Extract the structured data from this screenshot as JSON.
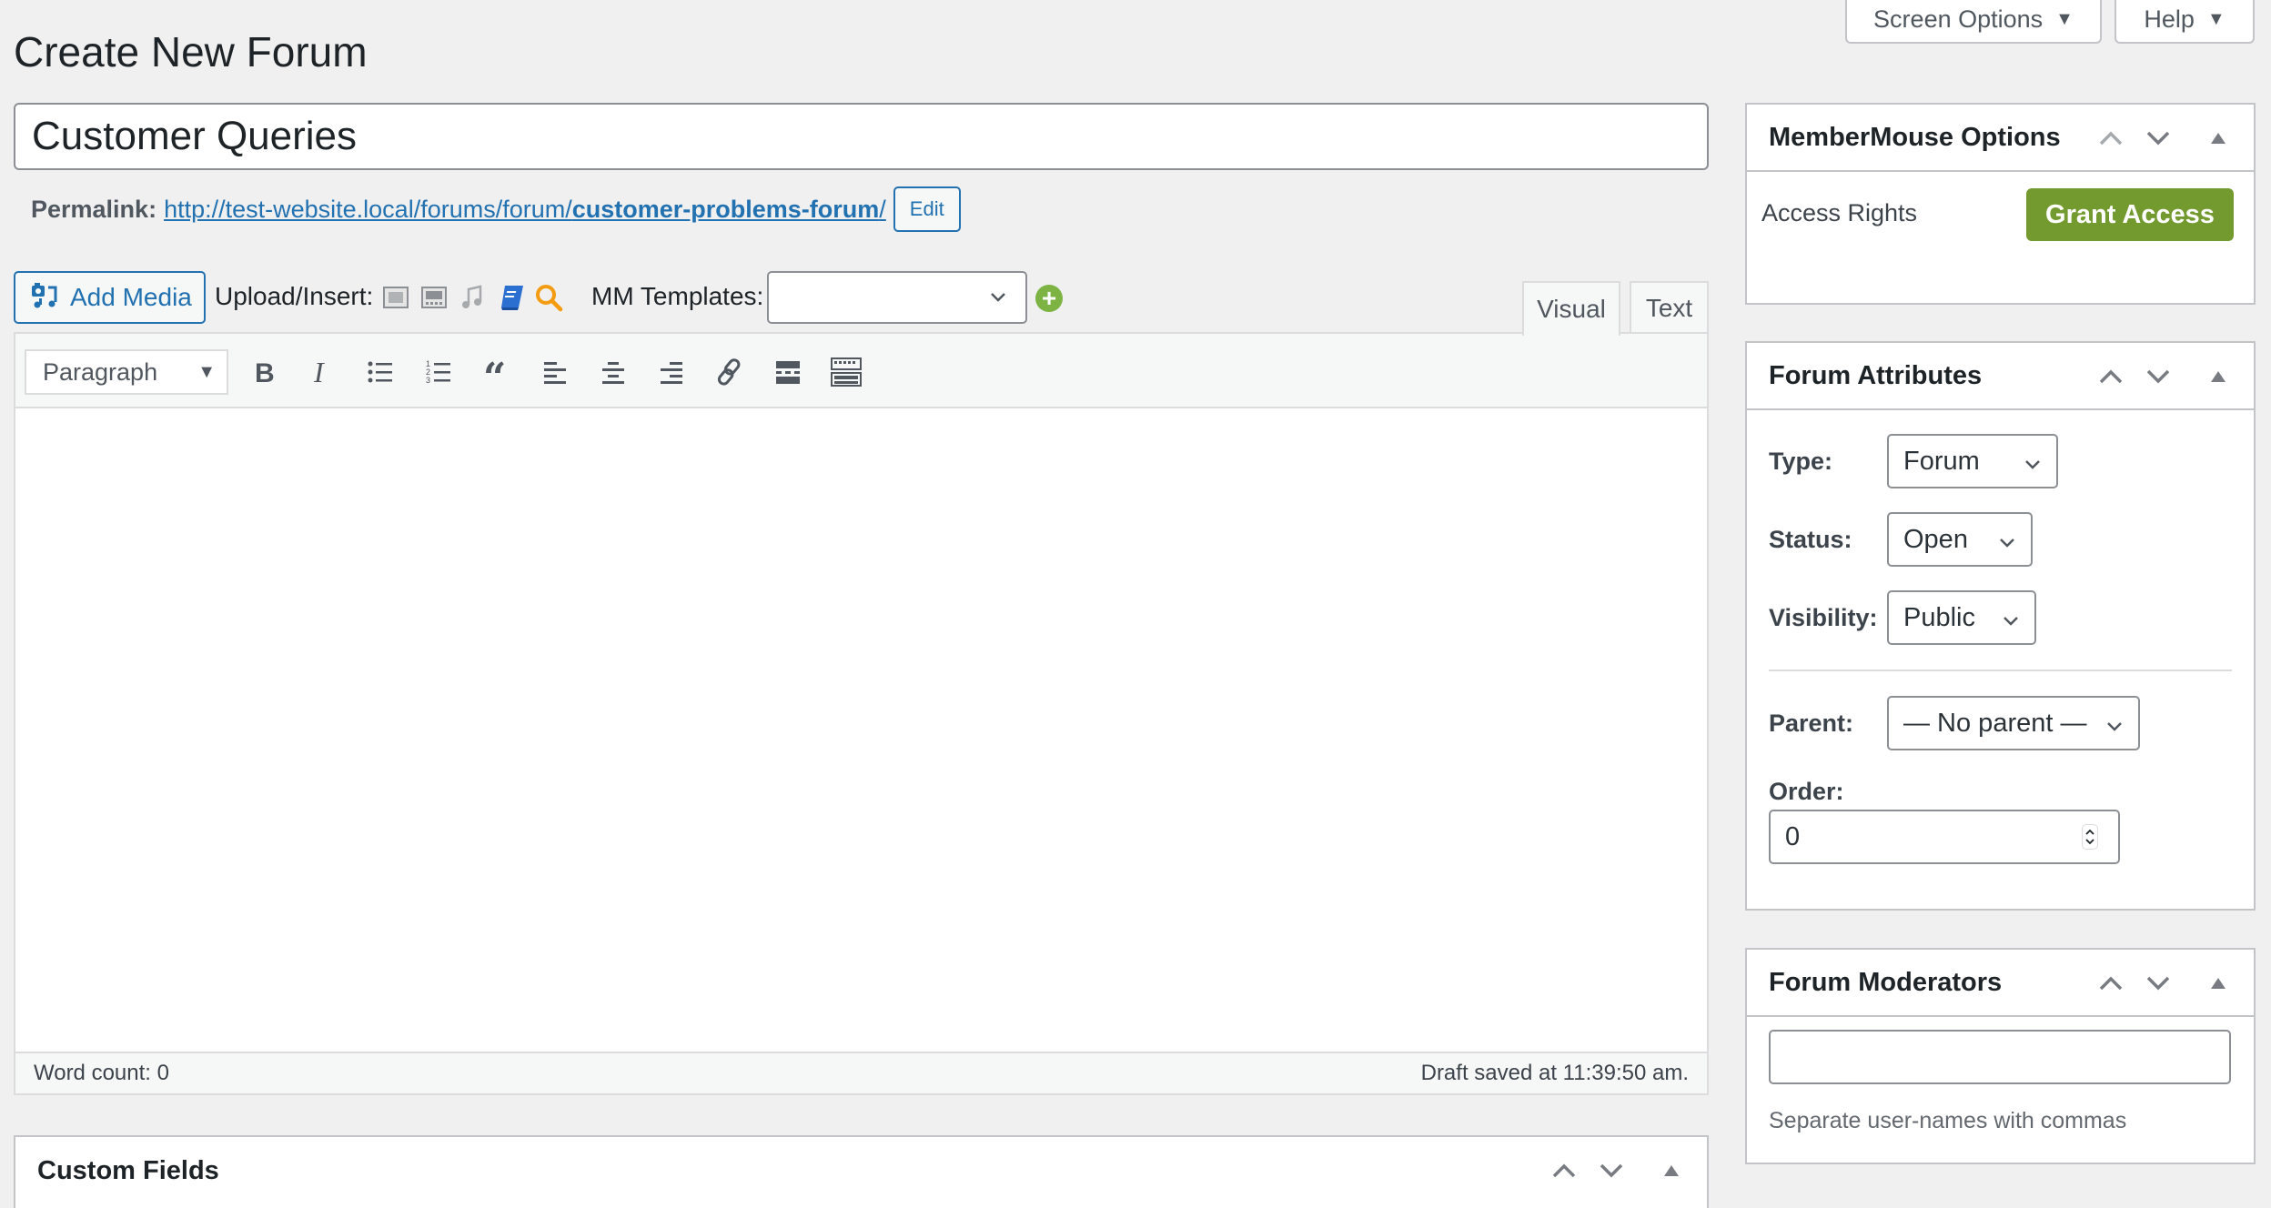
{
  "header": {
    "title": "Create New Forum",
    "screen_options_label": "Screen Options",
    "help_label": "Help"
  },
  "post": {
    "title_value": "Customer Queries",
    "permalink_label": "Permalink:",
    "permalink_base": "http://test-website.local/forums/forum/",
    "permalink_slug": "customer-problems-forum",
    "permalink_trailing": "/",
    "edit_label": "Edit"
  },
  "media_bar": {
    "add_media_label": "Add Media",
    "upload_insert_label": "Upload/Insert:",
    "upload_icons": [
      "image-icon",
      "gallery-icon",
      "audio-icon",
      "book-icon",
      "search-icon"
    ],
    "mm_templates_label": "MM Templates:",
    "mm_templates_value": ""
  },
  "editor": {
    "tabs": [
      {
        "label": "Visual",
        "active": true
      },
      {
        "label": "Text",
        "active": false
      }
    ],
    "format_select_value": "Paragraph",
    "toolbar_buttons": [
      "bold",
      "italic",
      "bulleted-list",
      "numbered-list",
      "blockquote",
      "align-left",
      "align-center",
      "align-right",
      "link",
      "read-more",
      "toolbar-toggle"
    ],
    "content": "",
    "word_count_label": "Word count: 0",
    "draft_saved_label": "Draft saved at 11:39:50 am."
  },
  "sidebar": {
    "membermouse": {
      "title": "MemberMouse Options",
      "access_rights_label": "Access Rights",
      "grant_access_label": "Grant Access",
      "accent_color": "#739a2f"
    },
    "forum_attributes": {
      "title": "Forum Attributes",
      "type_label": "Type:",
      "type_value": "Forum",
      "status_label": "Status:",
      "status_value": "Open",
      "visibility_label": "Visibility:",
      "visibility_value": "Public",
      "parent_label": "Parent:",
      "parent_value": "— No parent —",
      "order_label": "Order:",
      "order_value": "0"
    },
    "forum_moderators": {
      "title": "Forum Moderators",
      "input_value": "",
      "help_text": "Separate user-names with commas"
    }
  },
  "custom_fields": {
    "title": "Custom Fields"
  }
}
